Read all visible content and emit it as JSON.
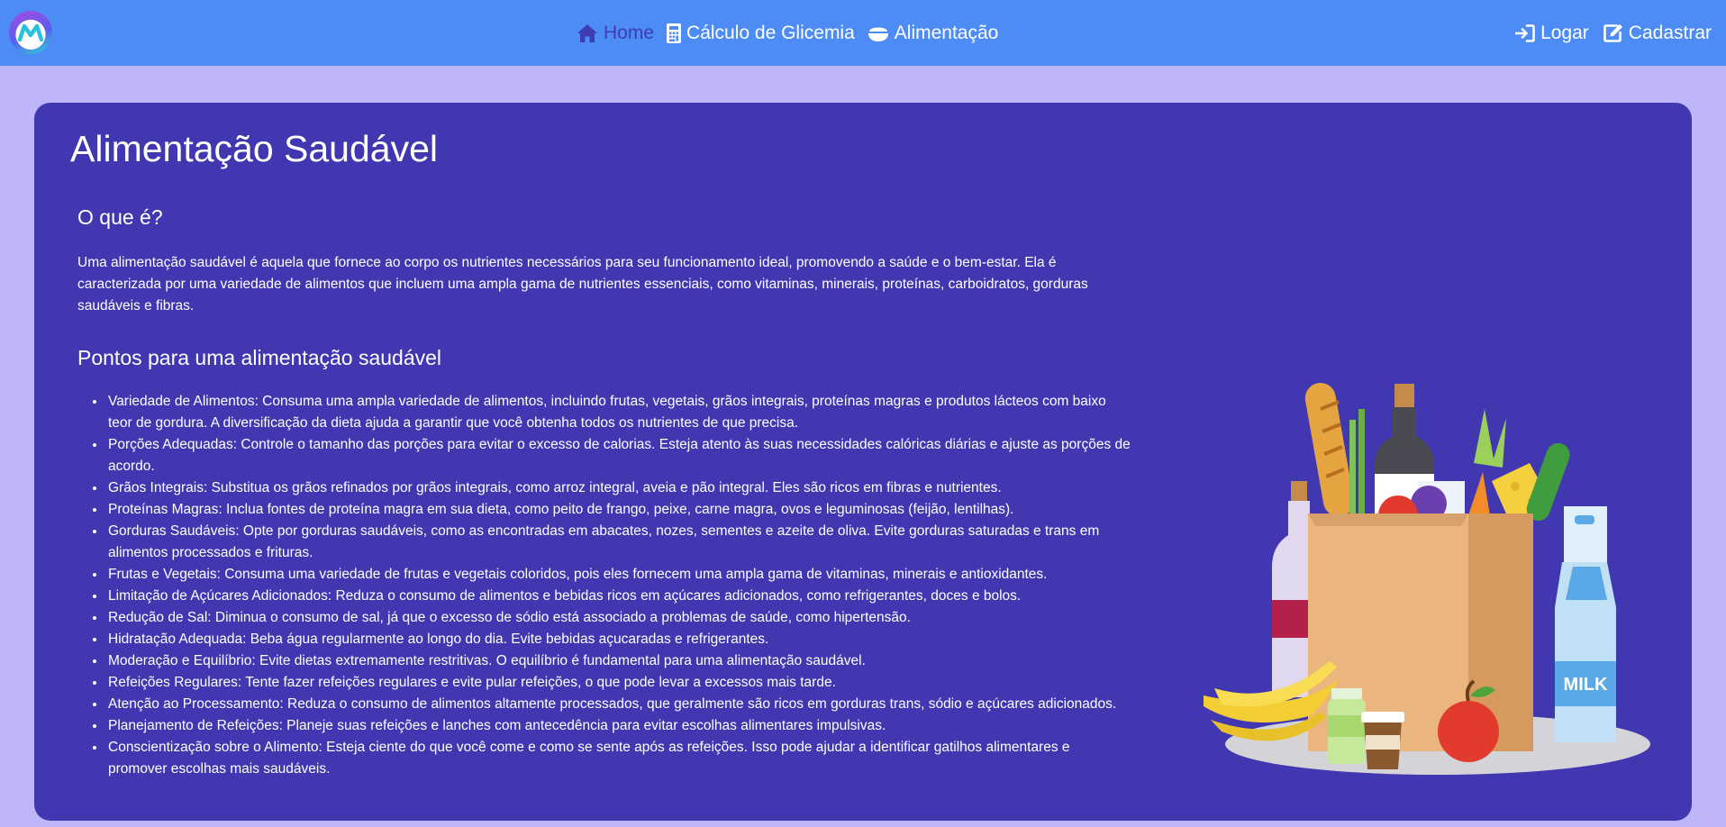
{
  "nav": {
    "logo_icon": "logo-m",
    "links": [
      {
        "label": "Home",
        "icon": "home-icon",
        "active": true
      },
      {
        "label": "Cálculo de Glicemia",
        "icon": "calculator-icon"
      },
      {
        "label": "Alimentação",
        "icon": "bowl-icon"
      }
    ],
    "auth": [
      {
        "label": "Logar",
        "icon": "sign-in-icon"
      },
      {
        "label": "Cadastrar",
        "icon": "edit-icon"
      }
    ]
  },
  "page": {
    "title": "Alimentação Saudável",
    "section1_title": "O que é?",
    "section1_text": "Uma alimentação saudável é aquela que fornece ao corpo os nutrientes necessários para seu funcionamento ideal, promovendo a saúde e o bem-estar. Ela é caracterizada por uma variedade de alimentos que incluem uma ampla gama de nutrientes essenciais, como vitaminas, minerais, proteínas, carboidratos, gorduras saudáveis e fibras.",
    "section2_title": "Pontos para uma alimentação saudável",
    "points": [
      "Variedade de Alimentos: Consuma uma ampla variedade de alimentos, incluindo frutas, vegetais, grãos integrais, proteínas magras e produtos lácteos com baixo teor de gordura. A diversificação da dieta ajuda a garantir que você obtenha todos os nutrientes de que precisa.",
      "Porções Adequadas: Controle o tamanho das porções para evitar o excesso de calorias. Esteja atento às suas necessidades calóricas diárias e ajuste as porções de acordo.",
      "Grãos Integrais: Substitua os grãos refinados por grãos integrais, como arroz integral, aveia e pão integral. Eles são ricos em fibras e nutrientes.",
      "Proteínas Magras: Inclua fontes de proteína magra em sua dieta, como peito de frango, peixe, carne magra, ovos e leguminosas (feijão, lentilhas).",
      "Gorduras Saudáveis: Opte por gorduras saudáveis, como as encontradas em abacates, nozes, sementes e azeite de oliva. Evite gorduras saturadas e trans em alimentos processados e frituras.",
      "Frutas e Vegetais: Consuma uma variedade de frutas e vegetais coloridos, pois eles fornecem uma ampla gama de vitaminas, minerais e antioxidantes.",
      "Limitação de Açúcares Adicionados: Reduza o consumo de alimentos e bebidas ricos em açúcares adicionados, como refrigerantes, doces e bolos.",
      "Redução de Sal: Diminua o consumo de sal, já que o excesso de sódio está associado a problemas de saúde, como hipertensão.",
      "Hidratação Adequada: Beba água regularmente ao longo do dia. Evite bebidas açucaradas e refrigerantes.",
      "Moderação e Equilíbrio: Evite dietas extremamente restritivas. O equilíbrio é fundamental para uma alimentação saudável.",
      "Refeições Regulares: Tente fazer refeições regulares e evite pular refeições, o que pode levar a excessos mais tarde.",
      "Atenção ao Processamento: Reduza o consumo de alimentos altamente processados, que geralmente são ricos em gorduras trans, sódio e açúcares adicionados.",
      "Planejamento de Refeições: Planeje suas refeições e lanches com antecedência para evitar escolhas alimentares impulsivas.",
      "Conscientização sobre o Alimento: Esteja ciente do que você come e como se sente após as refeições. Isso pode ajudar a identificar gatilhos alimentares e promover escolhas mais saudáveis."
    ],
    "illustration": {
      "icon": "grocery-bag-illustration",
      "milk_label": "MILK"
    }
  },
  "colors": {
    "navbar": "#4d8cf5",
    "background": "#bfb6fa",
    "card": "#4037b1",
    "active_link": "#3f3bb0"
  }
}
